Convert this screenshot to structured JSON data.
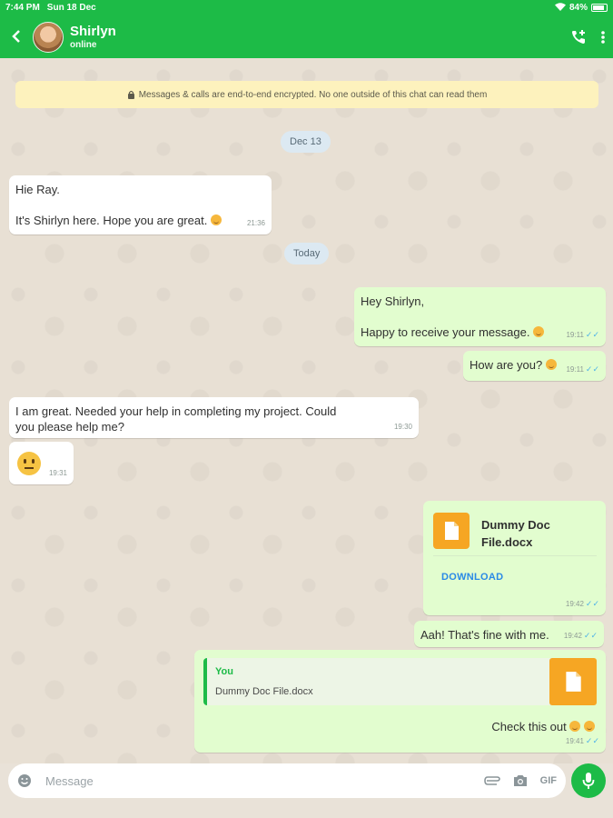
{
  "status": {
    "time": "7:44 PM",
    "date": "Sun 18 Dec",
    "battery": "84%"
  },
  "header": {
    "name": "Shirlyn",
    "presence": "online"
  },
  "banner": {
    "text": "Messages & calls are end-to-end encrypted. No one outside of this chat can read them"
  },
  "dates": {
    "first": "Dec 13",
    "second": "Today"
  },
  "messages": {
    "m1": {
      "line1": "Hie Ray.",
      "line2": "It's Shirlyn here. Hope you are great.",
      "time": "21:36"
    },
    "m2": {
      "line1": "Hey Shirlyn,",
      "line2": "Happy to receive your message.",
      "time": "19:11"
    },
    "m3": {
      "text": "How are you?",
      "time": "19:11"
    },
    "m4": {
      "line1": "I am great. Needed your help in completing my project. Could",
      "line2": "you please help me?",
      "time": "19:30"
    },
    "m5": {
      "time": "19:31"
    },
    "m6": {
      "filename_line1": "Dummy Doc",
      "filename_line2": "File.docx",
      "action": "DOWNLOAD",
      "time": "19:42"
    },
    "m7": {
      "text": "Aah! That's fine with me.",
      "time": "19:42"
    },
    "m8": {
      "quote_author": "You",
      "quote_text": "Dummy Doc File.docx",
      "text": "Check this out",
      "time": "19:41"
    }
  },
  "composer": {
    "placeholder": "Message",
    "gif": "GIF"
  },
  "colors": {
    "accent": "#1dbb47",
    "outgoing": "#e2fdcf",
    "incoming": "#ffffff",
    "banner": "#fdf2bd",
    "doc": "#f6a623"
  }
}
